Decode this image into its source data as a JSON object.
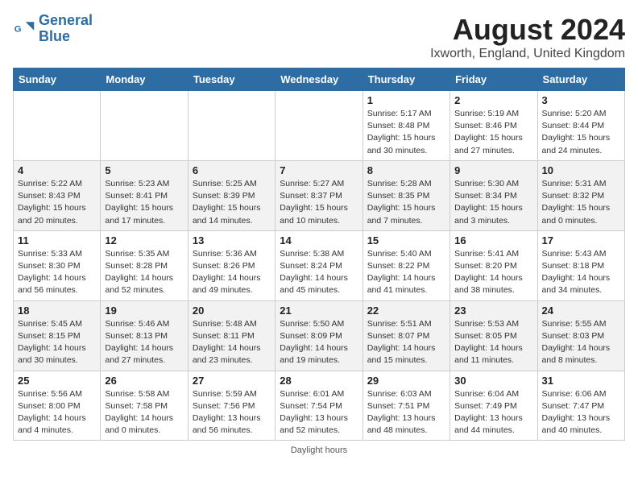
{
  "header": {
    "logo_line1": "General",
    "logo_line2": "Blue",
    "title": "August 2024",
    "subtitle": "Ixworth, England, United Kingdom"
  },
  "days_of_week": [
    "Sunday",
    "Monday",
    "Tuesday",
    "Wednesday",
    "Thursday",
    "Friday",
    "Saturday"
  ],
  "weeks": [
    [
      {
        "day": "",
        "info": ""
      },
      {
        "day": "",
        "info": ""
      },
      {
        "day": "",
        "info": ""
      },
      {
        "day": "",
        "info": ""
      },
      {
        "day": "1",
        "info": "Sunrise: 5:17 AM\nSunset: 8:48 PM\nDaylight: 15 hours and 30 minutes."
      },
      {
        "day": "2",
        "info": "Sunrise: 5:19 AM\nSunset: 8:46 PM\nDaylight: 15 hours and 27 minutes."
      },
      {
        "day": "3",
        "info": "Sunrise: 5:20 AM\nSunset: 8:44 PM\nDaylight: 15 hours and 24 minutes."
      }
    ],
    [
      {
        "day": "4",
        "info": "Sunrise: 5:22 AM\nSunset: 8:43 PM\nDaylight: 15 hours and 20 minutes."
      },
      {
        "day": "5",
        "info": "Sunrise: 5:23 AM\nSunset: 8:41 PM\nDaylight: 15 hours and 17 minutes."
      },
      {
        "day": "6",
        "info": "Sunrise: 5:25 AM\nSunset: 8:39 PM\nDaylight: 15 hours and 14 minutes."
      },
      {
        "day": "7",
        "info": "Sunrise: 5:27 AM\nSunset: 8:37 PM\nDaylight: 15 hours and 10 minutes."
      },
      {
        "day": "8",
        "info": "Sunrise: 5:28 AM\nSunset: 8:35 PM\nDaylight: 15 hours and 7 minutes."
      },
      {
        "day": "9",
        "info": "Sunrise: 5:30 AM\nSunset: 8:34 PM\nDaylight: 15 hours and 3 minutes."
      },
      {
        "day": "10",
        "info": "Sunrise: 5:31 AM\nSunset: 8:32 PM\nDaylight: 15 hours and 0 minutes."
      }
    ],
    [
      {
        "day": "11",
        "info": "Sunrise: 5:33 AM\nSunset: 8:30 PM\nDaylight: 14 hours and 56 minutes."
      },
      {
        "day": "12",
        "info": "Sunrise: 5:35 AM\nSunset: 8:28 PM\nDaylight: 14 hours and 52 minutes."
      },
      {
        "day": "13",
        "info": "Sunrise: 5:36 AM\nSunset: 8:26 PM\nDaylight: 14 hours and 49 minutes."
      },
      {
        "day": "14",
        "info": "Sunrise: 5:38 AM\nSunset: 8:24 PM\nDaylight: 14 hours and 45 minutes."
      },
      {
        "day": "15",
        "info": "Sunrise: 5:40 AM\nSunset: 8:22 PM\nDaylight: 14 hours and 41 minutes."
      },
      {
        "day": "16",
        "info": "Sunrise: 5:41 AM\nSunset: 8:20 PM\nDaylight: 14 hours and 38 minutes."
      },
      {
        "day": "17",
        "info": "Sunrise: 5:43 AM\nSunset: 8:18 PM\nDaylight: 14 hours and 34 minutes."
      }
    ],
    [
      {
        "day": "18",
        "info": "Sunrise: 5:45 AM\nSunset: 8:15 PM\nDaylight: 14 hours and 30 minutes."
      },
      {
        "day": "19",
        "info": "Sunrise: 5:46 AM\nSunset: 8:13 PM\nDaylight: 14 hours and 27 minutes."
      },
      {
        "day": "20",
        "info": "Sunrise: 5:48 AM\nSunset: 8:11 PM\nDaylight: 14 hours and 23 minutes."
      },
      {
        "day": "21",
        "info": "Sunrise: 5:50 AM\nSunset: 8:09 PM\nDaylight: 14 hours and 19 minutes."
      },
      {
        "day": "22",
        "info": "Sunrise: 5:51 AM\nSunset: 8:07 PM\nDaylight: 14 hours and 15 minutes."
      },
      {
        "day": "23",
        "info": "Sunrise: 5:53 AM\nSunset: 8:05 PM\nDaylight: 14 hours and 11 minutes."
      },
      {
        "day": "24",
        "info": "Sunrise: 5:55 AM\nSunset: 8:03 PM\nDaylight: 14 hours and 8 minutes."
      }
    ],
    [
      {
        "day": "25",
        "info": "Sunrise: 5:56 AM\nSunset: 8:00 PM\nDaylight: 14 hours and 4 minutes."
      },
      {
        "day": "26",
        "info": "Sunrise: 5:58 AM\nSunset: 7:58 PM\nDaylight: 14 hours and 0 minutes."
      },
      {
        "day": "27",
        "info": "Sunrise: 5:59 AM\nSunset: 7:56 PM\nDaylight: 13 hours and 56 minutes."
      },
      {
        "day": "28",
        "info": "Sunrise: 6:01 AM\nSunset: 7:54 PM\nDaylight: 13 hours and 52 minutes."
      },
      {
        "day": "29",
        "info": "Sunrise: 6:03 AM\nSunset: 7:51 PM\nDaylight: 13 hours and 48 minutes."
      },
      {
        "day": "30",
        "info": "Sunrise: 6:04 AM\nSunset: 7:49 PM\nDaylight: 13 hours and 44 minutes."
      },
      {
        "day": "31",
        "info": "Sunrise: 6:06 AM\nSunset: 7:47 PM\nDaylight: 13 hours and 40 minutes."
      }
    ]
  ],
  "footer": "Daylight hours"
}
